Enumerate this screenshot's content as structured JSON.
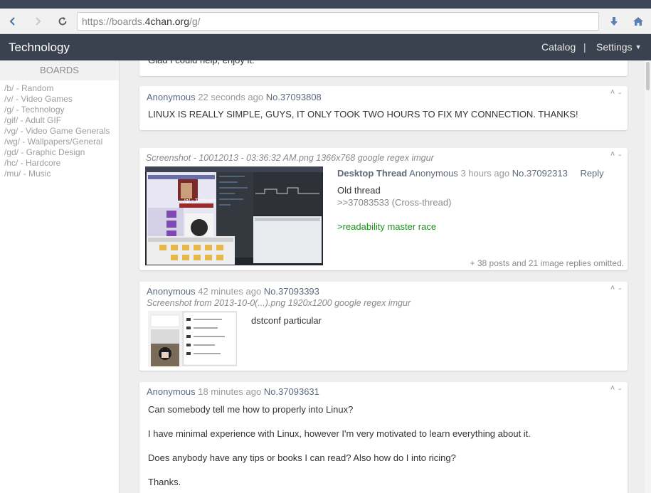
{
  "browser": {
    "url_prefix": "https://boards.",
    "url_domain": "4chan.org",
    "url_suffix": "/g/",
    "icons": [
      "back-arrow-icon",
      "forward-arrow-icon",
      "reload-icon",
      "download-icon",
      "home-icon"
    ]
  },
  "header": {
    "title": "Technology",
    "catalog": "Catalog",
    "separator": "|",
    "settings": "Settings"
  },
  "sidebar": {
    "heading": "BOARDS",
    "boards": [
      "/b/ - Random",
      "/v/ - Video Games",
      "/g/ - Technology",
      "/gif/ - Adult GIF",
      "/vg/ - Video Game Generals",
      "/wg/ - Wallpapers/General",
      "/gd/ - Graphic Design",
      "/hc/ - Hardcore",
      "/mu/ - Music"
    ]
  },
  "posts": {
    "partial": {
      "text": "Glad I could help, enjoy it."
    },
    "p1": {
      "name": "Anonymous",
      "date": "22 seconds ago",
      "no": "No.37093808",
      "text": "LINUX IS REALLY SIMPLE, GUYS, IT ONLY TOOK TWO HOURS TO FIX MY CONNECTION. THANKS!"
    },
    "thread": {
      "fileinfo": "Screenshot - 10012013 - 03:36:32 AM.png 1366x768",
      "file_links": [
        "google",
        "regex",
        "imgur"
      ],
      "subject": "Desktop Thread",
      "name": "Anonymous",
      "date": "3 hours ago",
      "no": "No.37092313",
      "reply": "Reply",
      "line1": "Old thread",
      "line2": ">>37083533 (Cross-thread)",
      "line3": ">readability master race",
      "omitted": "+ 38 posts and 21 image replies omitted."
    },
    "p2": {
      "name": "Anonymous",
      "date": "42 minutes ago",
      "no": "No.37093393",
      "fileinfo": "Screenshot from 2013-10-0(...).png 1920x1200",
      "file_links": [
        "google",
        "regex",
        "imgur"
      ],
      "text": "dstconf particular"
    },
    "p3": {
      "name": "Anonymous",
      "date": "18 minutes ago",
      "no": "No.37093631",
      "lines": [
        "Can somebody tell me how to properly into Linux?",
        "I have minimal experience with Linux, however I'm very motivated to learn everything about it.",
        "Does anybody have any tips or books I can read? Also how do I into ricing?",
        "Thanks."
      ]
    },
    "controls": "˄ ˗"
  },
  "thumbnails": {
    "thread_caption": "/g/ - Technology"
  }
}
